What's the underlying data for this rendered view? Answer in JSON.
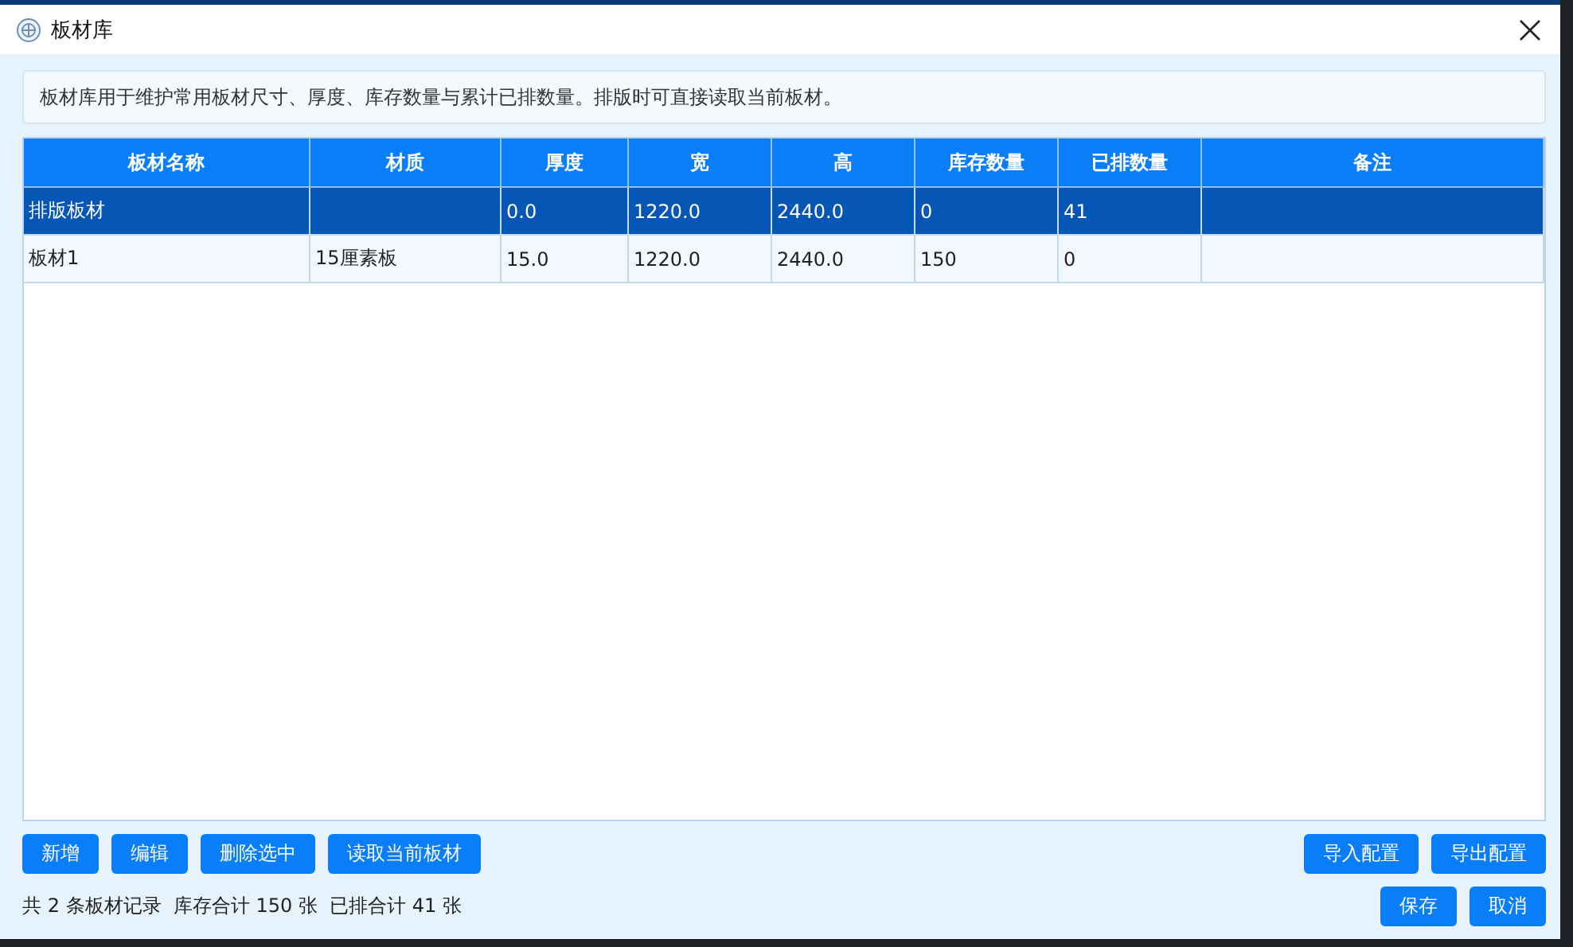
{
  "window": {
    "title": "板材库"
  },
  "description": "板材库用于维护常用板材尺寸、厚度、库存数量与累计已排数量。排版时可直接读取当前板材。",
  "table": {
    "columns": [
      "板材名称",
      "材质",
      "厚度",
      "宽",
      "高",
      "库存数量",
      "已排数量",
      "备注"
    ],
    "rows": [
      {
        "selected": true,
        "cells": [
          "排版板材",
          null,
          "0.0",
          "1220.0",
          "2440.0",
          "0",
          "41",
          null
        ]
      },
      {
        "selected": false,
        "cells": [
          "板材1",
          "15厘素板",
          "15.0",
          "1220.0",
          "2440.0",
          "150",
          "0",
          null
        ]
      }
    ]
  },
  "left_buttons": [
    "新增",
    "编辑",
    "删除选中",
    "读取当前板材"
  ],
  "right_buttons": [
    "导入配置",
    "导出配置"
  ],
  "summary": "共 2 条板材记录  库存合计 150 张  已排合计 41 张",
  "dialog_buttons": [
    "保存",
    "取消"
  ]
}
